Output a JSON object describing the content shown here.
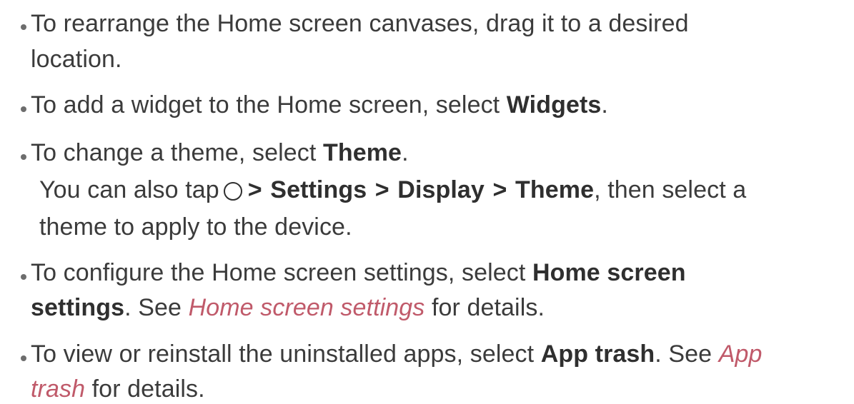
{
  "items": [
    {
      "lines": [
        "To rearrange the Home screen canvases, drag it to a desired",
        "location."
      ]
    },
    {
      "pre": "To add a widget to the Home screen, select ",
      "bold": "Widgets",
      "post": "."
    },
    {
      "pre": "To change a theme, select ",
      "bold": "Theme",
      "post": ".",
      "note": {
        "pre": "You can also tap",
        "icon": "home-circle-icon",
        "sep": ">",
        "path": [
          "Settings",
          "Display",
          "Theme"
        ],
        "post": ", then select a",
        "line2": "theme to apply to the device."
      }
    },
    {
      "pre": "To configure the Home screen settings, select ",
      "bold1": "Home screen",
      "bold2": "settings",
      "mid": ". See ",
      "link": "Home screen settings",
      "post": " for details."
    },
    {
      "pre": "To view or reinstall the uninstalled apps, select ",
      "bold": "App trash",
      "mid": ". See ",
      "link1": "App",
      "link2": "trash",
      "post": " for details."
    }
  ],
  "colors": {
    "text": "#3b3b3b",
    "link": "#c05a6a",
    "bullet": "#6d6d6d"
  }
}
